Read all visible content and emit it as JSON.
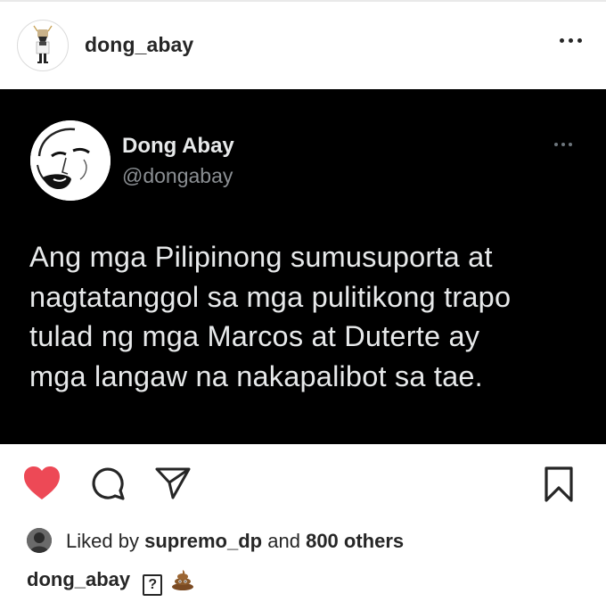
{
  "header": {
    "username": "dong_abay",
    "avatar_icon": "figure-avatar-icon",
    "more_icon": "more-horizontal-icon"
  },
  "tweet": {
    "display_name": "Dong Abay",
    "handle": "@dongabay",
    "lines": [
      "Ang mga Pilipinong sumusuporta at",
      "nagtatanggol sa mga pulitikong trapo",
      "tulad ng mga Marcos at Duterte ay",
      "mga langaw na nakapalibot sa tae."
    ],
    "colors": {
      "background": "#000000",
      "text": "#e7e9ea",
      "muted": "#8b8f93"
    }
  },
  "actions": {
    "like_icon": "heart-filled-icon",
    "comment_icon": "comment-icon",
    "share_icon": "send-icon",
    "save_icon": "bookmark-icon",
    "like_color": "#ed4956"
  },
  "likes": {
    "prefix": "Liked by",
    "user": "supremo_dp",
    "connector": "and",
    "others": "800 others"
  },
  "caption": {
    "username": "dong_abay",
    "unknown_glyph": "?",
    "emoji_icon": "pile-of-poo-icon"
  }
}
